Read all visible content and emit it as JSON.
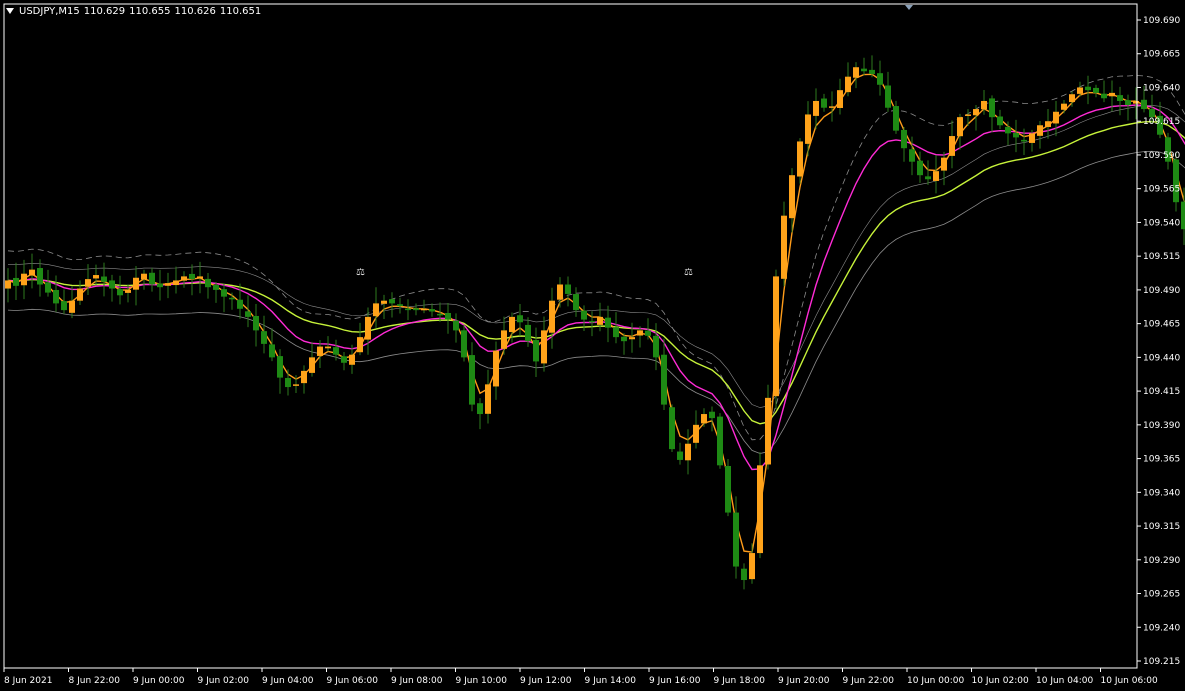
{
  "header": {
    "symbol": "USDJPY,M15",
    "open": "110.629",
    "high": "110.655",
    "low": "110.626",
    "close": "110.651"
  },
  "colors": {
    "background": "#000000",
    "bull_body": "#ffa31a",
    "bear_body": "#1e8a14",
    "wick": "#2e7a1e",
    "ma_fast": "#ff9c1a",
    "ma_fast_low": "#ffffff",
    "ma_mid": "#ff2bd6",
    "ma_slow": "#c6f23a",
    "band": "#8c8c8c",
    "axis_frame": "#ffffff"
  },
  "chart_data": {
    "type": "candlestick",
    "symbol": "USDJPY",
    "timeframe": "M15",
    "y_ticks": [
      "109.690",
      "109.665",
      "109.640",
      "109.615",
      "109.590",
      "109.565",
      "109.540",
      "109.515",
      "109.490",
      "109.465",
      "109.440",
      "109.415",
      "109.390",
      "109.365",
      "109.340",
      "109.315",
      "109.290",
      "109.265",
      "109.240",
      "109.215"
    ],
    "ylim": [
      109.205,
      109.7
    ],
    "x_ticks": [
      "8 Jun 2021",
      "8 Jun 22:00",
      "9 Jun 00:00",
      "9 Jun 02:00",
      "9 Jun 04:00",
      "9 Jun 06:00",
      "9 Jun 08:00",
      "9 Jun 10:00",
      "9 Jun 12:00",
      "9 Jun 14:00",
      "9 Jun 16:00",
      "9 Jun 18:00",
      "9 Jun 20:00",
      "9 Jun 22:00",
      "10 Jun 00:00",
      "10 Jun 02:00",
      "10 Jun 04:00",
      "10 Jun 06:00"
    ],
    "bars_per_tick": 8,
    "series_close": [
      109.497,
      109.493,
      109.502,
      109.505,
      109.494,
      109.488,
      109.48,
      109.475,
      109.482,
      109.491,
      109.498,
      109.501,
      109.496,
      109.491,
      109.486,
      109.49,
      109.499,
      109.502,
      109.494,
      109.492,
      109.495,
      109.497,
      109.5,
      109.498,
      109.5,
      109.492,
      109.49,
      109.485,
      109.483,
      109.476,
      109.47,
      109.46,
      109.45,
      109.44,
      109.425,
      109.418,
      109.42,
      109.43,
      109.44,
      109.448,
      109.448,
      109.442,
      109.436,
      109.442,
      109.455,
      109.47,
      109.48,
      109.482,
      109.48,
      109.478,
      109.476,
      109.475,
      109.476,
      109.474,
      109.472,
      109.468,
      109.46,
      109.44,
      109.405,
      109.398,
      109.42,
      109.445,
      109.46,
      109.47,
      109.466,
      109.452,
      109.437,
      109.46,
      109.482,
      109.494,
      109.487,
      109.475,
      109.468,
      109.466,
      109.47,
      109.462,
      109.455,
      109.452,
      109.455,
      109.46,
      109.456,
      109.44,
      109.405,
      109.372,
      109.364,
      109.376,
      109.39,
      109.398,
      109.395,
      109.36,
      109.325,
      109.285,
      109.275,
      109.295,
      109.36,
      109.41,
      109.5,
      109.545,
      109.575,
      109.6,
      109.62,
      109.63,
      109.625,
      109.626,
      109.638,
      109.648,
      109.655,
      109.652,
      109.65,
      109.642,
      109.625,
      109.608,
      109.595,
      109.585,
      109.575,
      109.572,
      109.578,
      109.588,
      109.604,
      109.618,
      109.62,
      109.624,
      109.63,
      109.618,
      109.612,
      109.606,
      109.603,
      109.6,
      109.606,
      109.612,
      109.615,
      109.622,
      109.628,
      109.635,
      109.64,
      109.638,
      109.636,
      109.632,
      109.636,
      109.63,
      109.627,
      109.63,
      109.624,
      109.618,
      109.605,
      109.585,
      109.555,
      109.535,
      109.527,
      109.532,
      109.545,
      109.56,
      109.556,
      109.55,
      109.548,
      109.544,
      109.549,
      109.557,
      109.567
    ]
  }
}
